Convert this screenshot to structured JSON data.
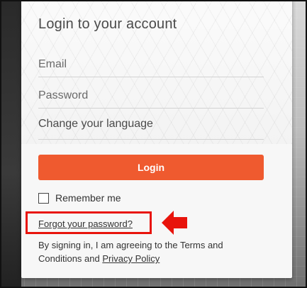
{
  "login": {
    "title": "Login to your account",
    "email_placeholder": "Email",
    "password_placeholder": "Password",
    "language_label": "Change your language",
    "login_button": "Login",
    "remember_label": "Remember me",
    "forgot_link": "Forgot your password?",
    "terms_prefix": "By signing in, I am agreeing to the Terms and Conditions and ",
    "privacy_link": "Privacy Policy"
  },
  "annotation": {
    "icon": "left-arrow-icon",
    "color": "#e8140c"
  },
  "colors": {
    "accent": "#ef5a2f"
  }
}
